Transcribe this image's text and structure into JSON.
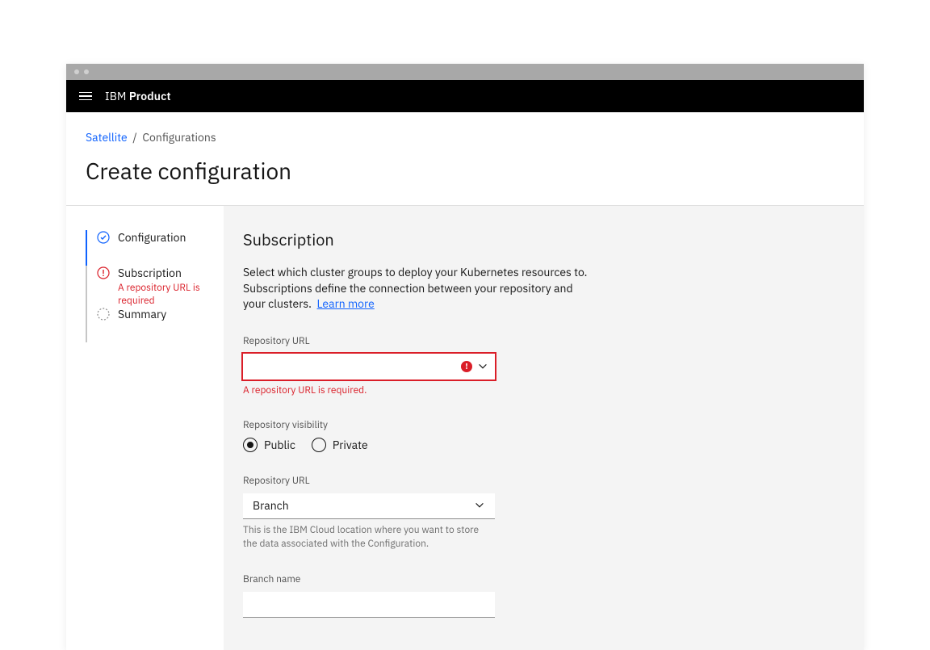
{
  "header": {
    "brand_prefix": "IBM",
    "brand_name": "Product"
  },
  "breadcrumb": {
    "root": "Satellite",
    "separator": "/",
    "current": "Configurations"
  },
  "page_title": "Create configuration",
  "steps": [
    {
      "label": "Configuration",
      "state": "complete"
    },
    {
      "label": "Subscription",
      "state": "error",
      "sub": "A repository URL is required"
    },
    {
      "label": "Summary",
      "state": "pending"
    }
  ],
  "main": {
    "title": "Subscription",
    "description": "Select which cluster groups to deploy your Kubernetes resources to. Subscriptions define the connection between your repository and your clusters.",
    "learn_more": "Learn more",
    "repo_url": {
      "label": "Repository URL",
      "value": "",
      "error": "A repository URL is required."
    },
    "visibility": {
      "label": "Repository visibility",
      "options": {
        "public": "Public",
        "private": "Private"
      },
      "selected": "public"
    },
    "repo_url2": {
      "label": "Repository URL",
      "selected": "Branch",
      "helper": "This is the IBM Cloud location where you want to store the data associated with the Configuration."
    },
    "branch_name": {
      "label": "Branch name",
      "value": ""
    }
  }
}
